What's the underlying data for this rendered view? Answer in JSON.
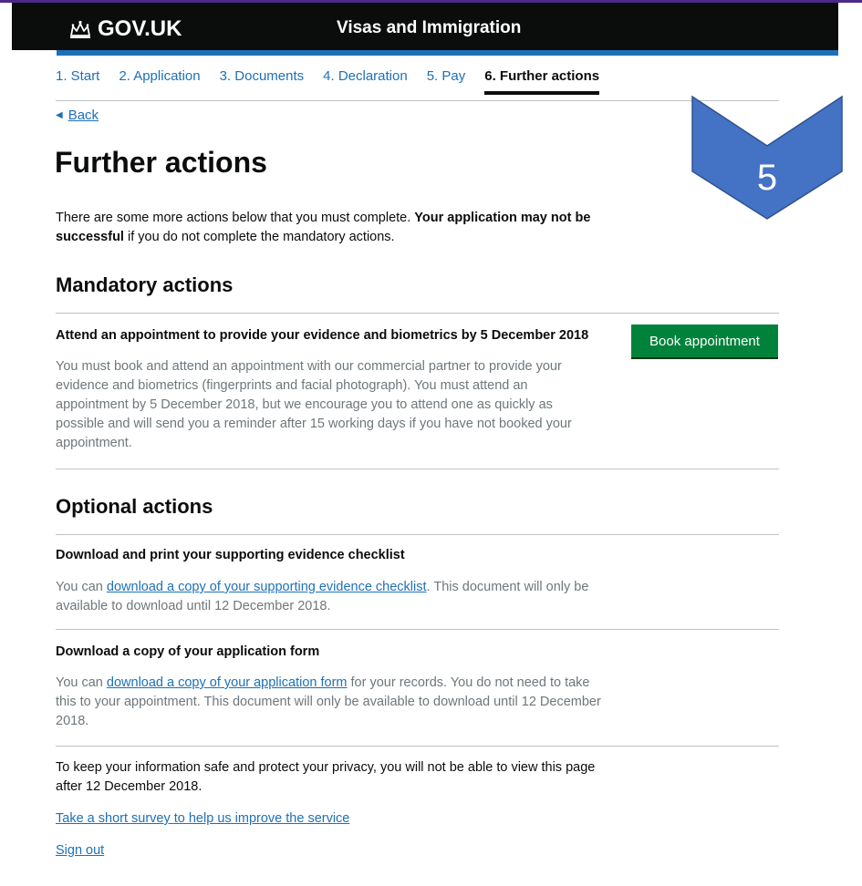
{
  "header": {
    "logo_text": "GOV.UK",
    "service_name": "Visas and Immigration",
    "crown_icon": "crown-icon"
  },
  "steps": [
    {
      "label": "1. Start"
    },
    {
      "label": "2. Application"
    },
    {
      "label": "3. Documents"
    },
    {
      "label": "4. Declaration"
    },
    {
      "label": "5. Pay"
    },
    {
      "label": "6. Further actions",
      "current": true
    }
  ],
  "back": {
    "label": "Back",
    "icon": "triangle-left-icon"
  },
  "page": {
    "title": "Further actions",
    "intro_text": "There are some more actions below that you must complete. ",
    "intro_bold": "Your application may not be successful",
    "intro_end": " if you do not complete the mandatory actions."
  },
  "mandatory": {
    "heading": "Mandatory actions",
    "task_title": "Attend an appointment to provide your evidence and biometrics by 5 December 2018",
    "task_desc": "You must book and attend an appointment with our commercial partner to provide your evidence and biometrics (fingerprints and facial photograph). You must attend an appointment by 5 December 2018, but we encourage you to attend one as quickly as possible and will send you a reminder after 15 working days if you have not booked your appointment.",
    "button_label": "Book appointment"
  },
  "optional": {
    "heading": "Optional actions",
    "task1_title": "Download and print your supporting evidence checklist",
    "task1_pre": "You can ",
    "task1_link": "download a copy of your supporting evidence checklist",
    "task1_post": ". This document will only be available to download until 12 December 2018.",
    "task2_title": "Download a copy of your application form",
    "task2_pre": "You can ",
    "task2_link": "download a copy of your application form",
    "task2_post": " for your records. You do not need to take this to your appointment. This document will only be available to download until 12 December 2018."
  },
  "footer": {
    "privacy": "To keep your information safe and protect your privacy, you will not be able to view this page after 12 December 2018.",
    "survey_link": "Take a short survey to help us improve the service",
    "sign_out": "Sign out"
  },
  "annotation": {
    "label": "5",
    "color": "#4472c4"
  },
  "colors": {
    "header_bg": "#0b0c0c",
    "header_stripe": "#1d70b8",
    "link": "#1d70b8",
    "button_green": "#00823b",
    "muted_text": "#6f777b"
  }
}
